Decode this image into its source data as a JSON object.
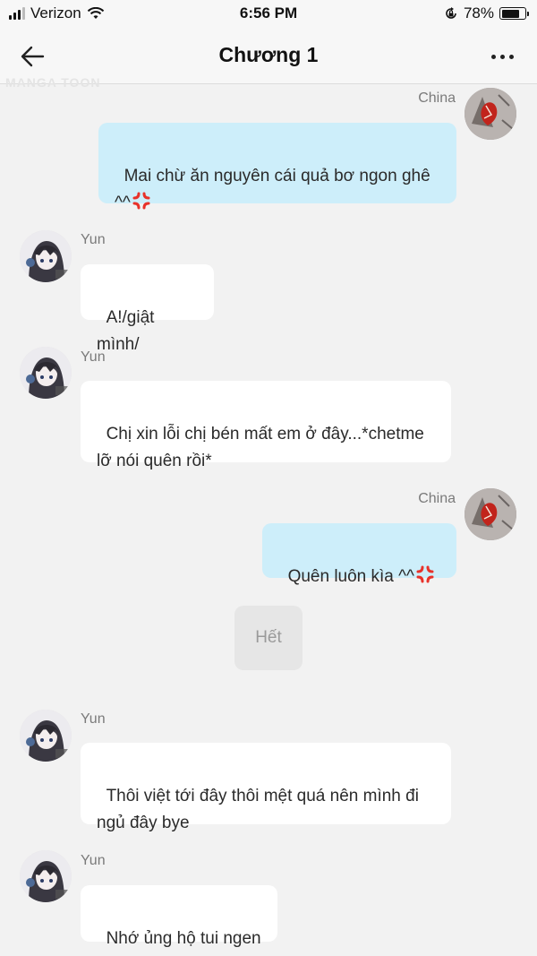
{
  "status_bar": {
    "carrier": "Verizon",
    "time": "6:56 PM",
    "battery": "78%",
    "battery_level": 0.78
  },
  "header": {
    "title": "Chương 1",
    "back_icon": "arrow-left-icon",
    "more_icon": "more-horizontal-icon"
  },
  "watermark": "MANGA TOON",
  "messages": [
    {
      "sender": "China",
      "side": "out",
      "text": "Mai chừ ăn nguyên cái quả bơ ngon ghê\n^^"
    },
    {
      "sender": "Yun",
      "side": "in",
      "text": "A!/giật mình/"
    },
    {
      "sender": "Yun",
      "side": "in",
      "text": "Chị xin lỗi chị bén mất em ở đây...*chetme\nlỡ nói quên rồi*"
    },
    {
      "sender": "China",
      "side": "out",
      "text": "Quên luôn kìa ^^"
    },
    {
      "sender": "Yun",
      "side": "in",
      "text": "Thôi việt tới đây thôi mệt quá nên mình đi\nngủ đây bye"
    },
    {
      "sender": "Yun",
      "side": "in",
      "text": "Nhớ ủng hộ tui ngen"
    }
  ],
  "end_label": "Hết",
  "colors": {
    "outgoing_bubble": "#cdeefa",
    "incoming_bubble": "#ffffff",
    "background": "#f2f2f2",
    "anger_emoji": "#e8322a"
  }
}
